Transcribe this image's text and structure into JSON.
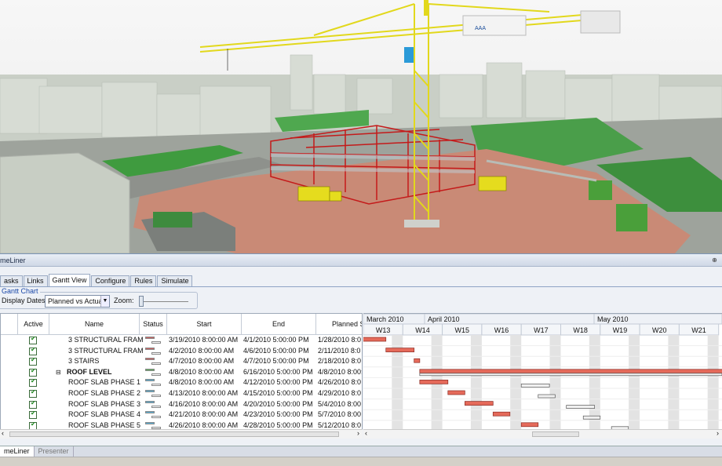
{
  "panel": {
    "title": "meLiner"
  },
  "tabs": [
    {
      "label": "asks"
    },
    {
      "label": "Links"
    },
    {
      "label": "Gantt View"
    },
    {
      "label": "Configure"
    },
    {
      "label": "Rules"
    },
    {
      "label": "Simulate"
    }
  ],
  "gantt_group": {
    "legend": "Gantt Chart",
    "display_label": "Display Dates:",
    "display_value": "Planned vs Actual",
    "zoom_label": "Zoom:"
  },
  "columns": [
    "Active",
    "Name",
    "Status",
    "Start",
    "End",
    "Planned St"
  ],
  "rows": [
    {
      "name": "3 STRUCTURAL FRAM...",
      "start": "3/19/2010 8:00:00 AM",
      "end": "4/1/2010 5:00:00 PM",
      "planned": "1/28/2010 8:0",
      "bold": false,
      "status_color": "#d06060"
    },
    {
      "name": "3 STRUCTURAL FRAM...",
      "start": "4/2/2010 8:00:00 AM",
      "end": "4/6/2010 5:00:00 PM",
      "planned": "2/11/2010 8:0",
      "bold": false,
      "status_color": "#d06060"
    },
    {
      "name": "3 STAIRS",
      "start": "4/7/2010 8:00:00 AM",
      "end": "4/7/2010 5:00:00 PM",
      "planned": "2/18/2010 8:0",
      "bold": false,
      "status_color": "#d06060"
    },
    {
      "name": "ROOF LEVEL",
      "start": "4/8/2010 8:00:00 AM",
      "end": "6/16/2010 5:00:00 PM",
      "planned": "4/8/2010 8:00:0",
      "bold": true,
      "status_color": "#5bb05b"
    },
    {
      "name": "ROOF SLAB PHASE 1",
      "start": "4/8/2010 8:00:00 AM",
      "end": "4/12/2010 5:00:00 PM",
      "planned": "4/26/2010 8:0",
      "bold": false,
      "status_color": "#56b0d8"
    },
    {
      "name": "ROOF SLAB PHASE 2",
      "start": "4/13/2010 8:00:00 AM",
      "end": "4/15/2010 5:00:00 PM",
      "planned": "4/29/2010 8:0",
      "bold": false,
      "status_color": "#56b0d8"
    },
    {
      "name": "ROOF SLAB PHASE 3",
      "start": "4/16/2010 8:00:00 AM",
      "end": "4/20/2010 5:00:00 PM",
      "planned": "5/4/2010 8:00",
      "bold": false,
      "status_color": "#56b0d8"
    },
    {
      "name": "ROOF SLAB PHASE 4",
      "start": "4/21/2010 8:00:00 AM",
      "end": "4/23/2010 5:00:00 PM",
      "planned": "5/7/2010 8:00",
      "bold": false,
      "status_color": "#56b0d8"
    },
    {
      "name": "ROOF SLAB PHASE 5",
      "start": "4/26/2010 8:00:00 AM",
      "end": "4/28/2010 5:00:00 PM",
      "planned": "5/12/2010 8:0",
      "bold": false,
      "status_color": "#56b0d8"
    }
  ],
  "gantt": {
    "months": [
      "March 2010",
      "April 2010",
      "May 2010"
    ],
    "weeks": [
      "W13",
      "W14",
      "W15",
      "W16",
      "W17",
      "W18",
      "W19",
      "W20",
      "W21"
    ]
  },
  "bottom_tabs": [
    {
      "label": "meLiner"
    },
    {
      "label": "Presenter"
    }
  ],
  "sign": {
    "text": "AAA"
  }
}
